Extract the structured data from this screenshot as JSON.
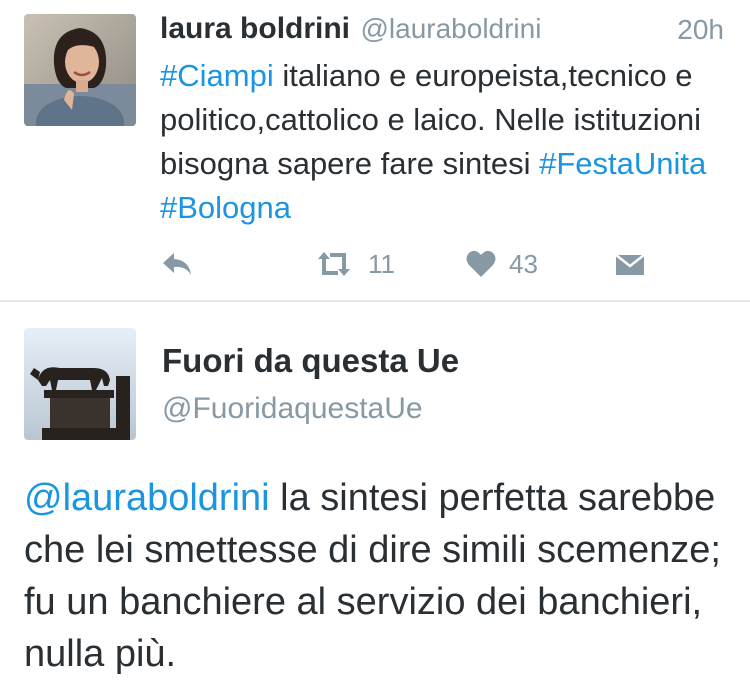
{
  "tweet1": {
    "author_name": "laura boldrini",
    "author_handle": "@lauraboldrini",
    "time": "20h",
    "text_segments": [
      {
        "text": "#Ciampi",
        "type": "hashtag"
      },
      {
        "text": " italiano e europeista,tecnico e politico,cattolico e laico. Nelle istituzioni bisogna sapere fare sintesi ",
        "type": "text"
      },
      {
        "text": "#FestaUnita",
        "type": "hashtag"
      },
      {
        "text": " ",
        "type": "text"
      },
      {
        "text": "#Bologna",
        "type": "hashtag"
      }
    ],
    "retweet_count": "11",
    "like_count": "43",
    "icons": {
      "reply": "reply-icon",
      "retweet": "retweet-icon",
      "like": "heart-icon",
      "dm": "direct-message-icon"
    }
  },
  "tweet2": {
    "author_name": "Fuori da questa Ue",
    "author_handle": "@FuoridaquestaUe",
    "text_segments": [
      {
        "text": "@lauraboldrini",
        "type": "mention"
      },
      {
        "text": " la sintesi perfetta sarebbe che lei smettesse di dire simili scemenze; fu un banchiere al servizio dei banchieri, nulla più.",
        "type": "text"
      }
    ]
  },
  "colors": {
    "link": "#1b95e0",
    "text": "#292f33",
    "muted": "#8899a6",
    "divider": "#e1e8ed"
  }
}
